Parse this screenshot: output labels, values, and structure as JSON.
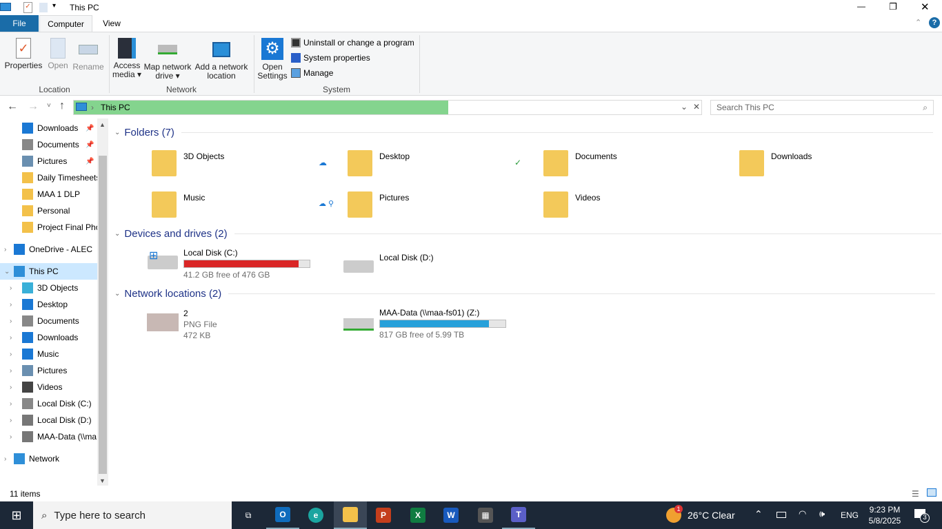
{
  "window": {
    "title": "This PC",
    "minimize": "—",
    "restore": "❐",
    "close": "✕"
  },
  "ribbon_tabs": [
    {
      "label": "File"
    },
    {
      "label": "Computer"
    },
    {
      "label": "View"
    }
  ],
  "ribbon": {
    "location": {
      "label": "Location",
      "properties": "Properties",
      "open": "Open",
      "rename": "Rename"
    },
    "network": {
      "label": "Network",
      "access_media": "Access",
      "access_media2": "media",
      "map_drive": "Map network",
      "map_drive2": "drive",
      "add_location": "Add a network",
      "add_location2": "location"
    },
    "system": {
      "label": "System",
      "open_settings": "Open",
      "open_settings2": "Settings",
      "uninstall": "Uninstall or change a program",
      "system_properties": "System properties",
      "manage": "Manage"
    }
  },
  "address": {
    "path": "This PC",
    "search_placeholder": "Search This PC"
  },
  "nav": {
    "items": [
      {
        "label": "Downloads",
        "pinned": true
      },
      {
        "label": "Documents",
        "pinned": true
      },
      {
        "label": "Pictures",
        "pinned": true
      },
      {
        "label": "Daily Timesheets"
      },
      {
        "label": "MAA 1 DLP"
      },
      {
        "label": "Personal"
      },
      {
        "label": "Project Final Pho"
      },
      {
        "label": "OneDrive - ALEC"
      },
      {
        "label": "This PC"
      },
      {
        "label": "3D Objects"
      },
      {
        "label": "Desktop"
      },
      {
        "label": "Documents"
      },
      {
        "label": "Downloads"
      },
      {
        "label": "Music"
      },
      {
        "label": "Pictures"
      },
      {
        "label": "Videos"
      },
      {
        "label": "Local Disk (C:)"
      },
      {
        "label": "Local Disk (D:)"
      },
      {
        "label": "MAA-Data (\\\\ma"
      },
      {
        "label": "Network"
      }
    ]
  },
  "content": {
    "folders_header": "Folders (7)",
    "folders": [
      {
        "name": "3D Objects"
      },
      {
        "name": "Desktop"
      },
      {
        "name": "Documents"
      },
      {
        "name": "Downloads"
      },
      {
        "name": "Music"
      },
      {
        "name": "Pictures"
      },
      {
        "name": "Videos"
      }
    ],
    "drives_header": "Devices and drives (2)",
    "drives": [
      {
        "name": "Local Disk (C:)",
        "free": "41.2 GB free of 476 GB",
        "used_fraction": 0.913,
        "bar_color": "#da2626"
      },
      {
        "name": "Local Disk (D:)"
      }
    ],
    "network_header": "Network locations (2)",
    "network": [
      {
        "name": "2",
        "type": "PNG File",
        "size": "472 KB"
      },
      {
        "name": "MAA-Data (\\\\maa-fs01) (Z:)",
        "free": "817 GB free of 5.99 TB",
        "used_fraction": 0.867,
        "bar_color": "#26a0da"
      }
    ]
  },
  "status": {
    "count": "11 items"
  },
  "taskbar": {
    "search_placeholder": "Type here to search",
    "weather": "26°C  Clear",
    "weather_badge": "1",
    "lang": "ENG",
    "time": "9:23 PM",
    "date": "5/8/2025",
    "notifications": "3"
  }
}
